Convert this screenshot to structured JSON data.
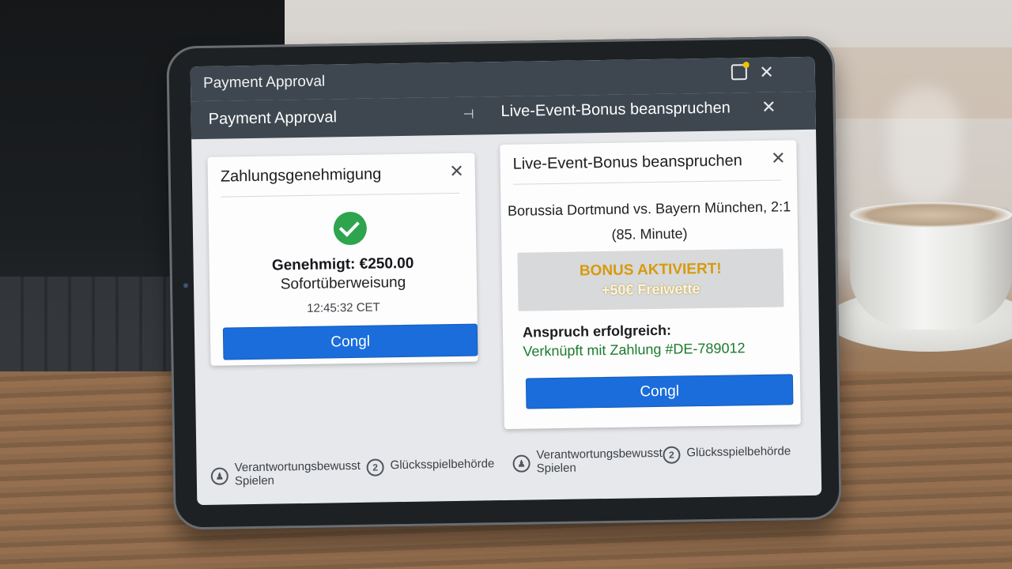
{
  "titlebar": {
    "title": "Payment Approval"
  },
  "tabs": {
    "left_label": "Payment Approval",
    "pin_glyph": "⊣",
    "right_label": "Live-Event-Bonus beanspruchen"
  },
  "payment_card": {
    "title": "Zahlungsgenehmigung",
    "status": "Genehmigt: €250.00",
    "method": "Sofortüberweisung",
    "time": "12:45:32 CET",
    "button_label": "Congl"
  },
  "bonus_card": {
    "title": "Live-Event-Bonus beanspruchen",
    "match_line1": "Borussia Dortmund vs. Bayern München, 2:1",
    "match_line2": "(85. Minute)",
    "bonus_title": "BONUS AKTIVIERT!",
    "bonus_amount": "+50€ Freiwette",
    "claim_label": "Anspruch erfolgreich:",
    "claim_link": "Verknüpft mit Zahlung #DE-789012",
    "button_label": "Congl"
  },
  "footer": {
    "left": {
      "responsible_line1": "Verantwortungsbewusst",
      "responsible_line2": "Spielen",
      "authority": "Glücksspielbehörde",
      "authority_badge": "2"
    },
    "right": {
      "responsible_line1": "Verantwortungsbewusst",
      "responsible_line2": "Spielen",
      "authority": "Glücksspielbehörde",
      "authority_badge": "2"
    }
  },
  "colors": {
    "accent_blue": "#1a6ddb",
    "success_green": "#2ea44f",
    "bonus_gold": "#d79a0b",
    "link_green": "#1a7b2c",
    "header_dark": "#3e4750"
  }
}
